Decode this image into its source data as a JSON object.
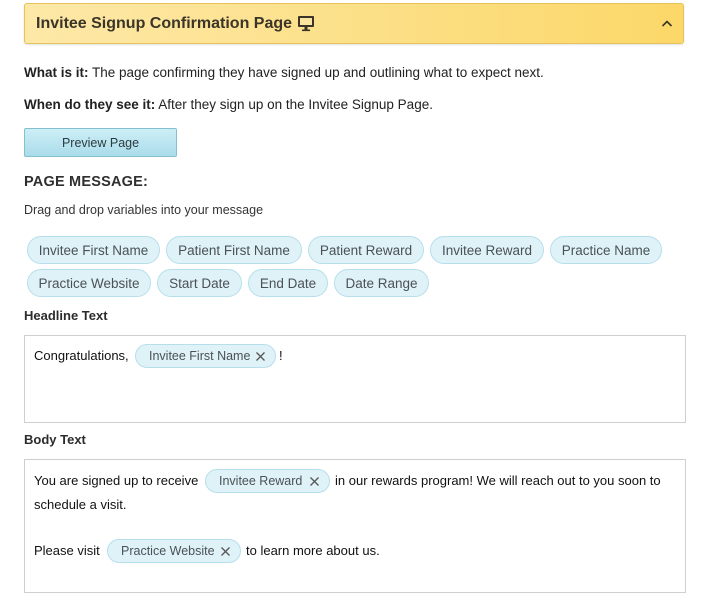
{
  "header": {
    "title": "Invitee Signup Confirmation Page",
    "monitor_icon": "monitor-icon",
    "chevron_icon": "chevron-up-icon",
    "bg_color": "#fcd869"
  },
  "info": {
    "what_label": "What is it:",
    "what_text": " The page confirming they have signed up and outlining what to expect next.",
    "when_label": "When do they see it:",
    "when_text": " After they sign up on the Invitee Signup Page."
  },
  "preview_button": {
    "label": "Preview Page"
  },
  "page_message": {
    "title": "PAGE MESSAGE:",
    "subtitle": "Drag and drop variables into your message",
    "variables": [
      "Invitee First Name",
      "Patient First Name",
      "Patient Reward",
      "Invitee Reward",
      "Practice Name",
      "Practice Website",
      "Start Date",
      "End Date",
      "Date Range"
    ]
  },
  "headline": {
    "label": "Headline Text",
    "text_before": "Congratulations,",
    "token": "Invitee First Name",
    "text_after": "!"
  },
  "body": {
    "label": "Body Text",
    "line1_before": "You are signed up to receive",
    "line1_token": "Invitee Reward",
    "line1_after": "in our rewards program! We will reach out to you soon to",
    "line2": "schedule a visit.",
    "line3_before": "Please visit",
    "line3_token": "Practice Website",
    "line3_after": "to learn more about us."
  },
  "colors": {
    "chip_bg": "#dff2f8",
    "chip_border": "#b6dfeb",
    "button_bg": "#aadcea"
  }
}
